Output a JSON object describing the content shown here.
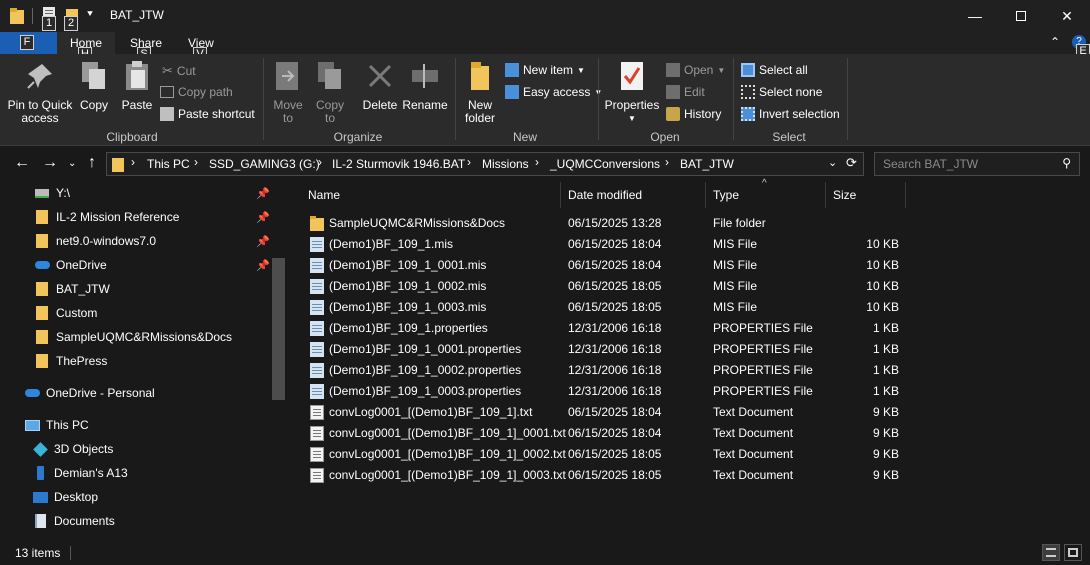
{
  "window": {
    "title": "BAT_JTW"
  },
  "keytips": {
    "qa1": "1",
    "qa2": "2",
    "file": "F",
    "home": "H",
    "share": "S",
    "view": "V",
    "help": "E"
  },
  "tabs": {
    "file": "",
    "home": "Home",
    "share": "Share",
    "view": "View"
  },
  "ribbon": {
    "clipboard": {
      "label": "Clipboard",
      "pin": "Pin to Quick access",
      "copy": "Copy",
      "paste": "Paste",
      "cut": "Cut",
      "copy_path": "Copy path",
      "paste_shortcut": "Paste shortcut"
    },
    "organize": {
      "label": "Organize",
      "move_to": "Move to",
      "copy_to": "Copy to",
      "delete": "Delete",
      "rename": "Rename"
    },
    "new": {
      "label": "New",
      "new_folder": "New folder",
      "new_item": "New item",
      "easy_access": "Easy access"
    },
    "open": {
      "label": "Open",
      "properties": "Properties",
      "open": "Open",
      "edit": "Edit",
      "history": "History"
    },
    "select": {
      "label": "Select",
      "select_all": "Select all",
      "select_none": "Select none",
      "invert": "Invert selection"
    }
  },
  "address": {
    "crumbs": [
      "This PC",
      "SSD_GAMING3 (G:)",
      "IL-2 Sturmovik 1946.BAT",
      "Missions",
      "_UQMCConversions",
      "BAT_JTW"
    ],
    "search_placeholder": "Search BAT_JTW"
  },
  "nav": {
    "items": [
      {
        "label": "Y:\\",
        "icon": "network-drive-icon",
        "pinned": true
      },
      {
        "label": "IL-2 Mission Reference",
        "icon": "folder-icon",
        "pinned": true
      },
      {
        "label": "net9.0-windows7.0",
        "icon": "folder-icon",
        "pinned": true
      },
      {
        "label": "OneDrive",
        "icon": "onedrive-icon",
        "pinned": true
      },
      {
        "label": "BAT_JTW",
        "icon": "folder-icon",
        "pinned": false
      },
      {
        "label": "Custom",
        "icon": "folder-icon",
        "pinned": false
      },
      {
        "label": "SampleUQMC&RMissions&Docs",
        "icon": "folder-icon",
        "pinned": false
      },
      {
        "label": "ThePress",
        "icon": "folder-icon",
        "pinned": false
      },
      {
        "label": "OneDrive - Personal",
        "icon": "onedrive-icon",
        "pinned": false
      },
      {
        "label": "This PC",
        "icon": "this-pc-icon",
        "pinned": false
      },
      {
        "label": "3D Objects",
        "icon": "3d-objects-icon",
        "pinned": false
      },
      {
        "label": "Demian's A13",
        "icon": "phone-icon",
        "pinned": false
      },
      {
        "label": "Desktop",
        "icon": "desktop-icon",
        "pinned": false
      },
      {
        "label": "Documents",
        "icon": "documents-icon",
        "pinned": false
      }
    ]
  },
  "columns": {
    "name": "Name",
    "date": "Date modified",
    "type": "Type",
    "size": "Size"
  },
  "files": [
    {
      "name": "SampleUQMC&RMissions&Docs",
      "date": "06/15/2025 13:28",
      "type": "File folder",
      "size": "",
      "icon": "folder-icon"
    },
    {
      "name": "(Demo1)BF_109_1.mis",
      "date": "06/15/2025 18:04",
      "type": "MIS File",
      "size": "10 KB",
      "icon": "config-file-icon"
    },
    {
      "name": "(Demo1)BF_109_1_0001.mis",
      "date": "06/15/2025 18:04",
      "type": "MIS File",
      "size": "10 KB",
      "icon": "config-file-icon"
    },
    {
      "name": "(Demo1)BF_109_1_0002.mis",
      "date": "06/15/2025 18:05",
      "type": "MIS File",
      "size": "10 KB",
      "icon": "config-file-icon"
    },
    {
      "name": "(Demo1)BF_109_1_0003.mis",
      "date": "06/15/2025 18:05",
      "type": "MIS File",
      "size": "10 KB",
      "icon": "config-file-icon"
    },
    {
      "name": "(Demo1)BF_109_1.properties",
      "date": "12/31/2006 16:18",
      "type": "PROPERTIES File",
      "size": "1 KB",
      "icon": "config-file-icon"
    },
    {
      "name": "(Demo1)BF_109_1_0001.properties",
      "date": "12/31/2006 16:18",
      "type": "PROPERTIES File",
      "size": "1 KB",
      "icon": "config-file-icon"
    },
    {
      "name": "(Demo1)BF_109_1_0002.properties",
      "date": "12/31/2006 16:18",
      "type": "PROPERTIES File",
      "size": "1 KB",
      "icon": "config-file-icon"
    },
    {
      "name": "(Demo1)BF_109_1_0003.properties",
      "date": "12/31/2006 16:18",
      "type": "PROPERTIES File",
      "size": "1 KB",
      "icon": "config-file-icon"
    },
    {
      "name": "convLog0001_[(Demo1)BF_109_1].txt",
      "date": "06/15/2025 18:04",
      "type": "Text Document",
      "size": "9 KB",
      "icon": "text-file-icon"
    },
    {
      "name": "convLog0001_[(Demo1)BF_109_1]_0001.txt",
      "date": "06/15/2025 18:04",
      "type": "Text Document",
      "size": "9 KB",
      "icon": "text-file-icon"
    },
    {
      "name": "convLog0001_[(Demo1)BF_109_1]_0002.txt",
      "date": "06/15/2025 18:05",
      "type": "Text Document",
      "size": "9 KB",
      "icon": "text-file-icon"
    },
    {
      "name": "convLog0001_[(Demo1)BF_109_1]_0003.txt",
      "date": "06/15/2025 18:05",
      "type": "Text Document",
      "size": "9 KB",
      "icon": "text-file-icon"
    }
  ],
  "status": {
    "count": "13 items"
  },
  "colors": {
    "accent": "#1a5fb4",
    "folder": "#f2c55c",
    "background": "#191919"
  }
}
